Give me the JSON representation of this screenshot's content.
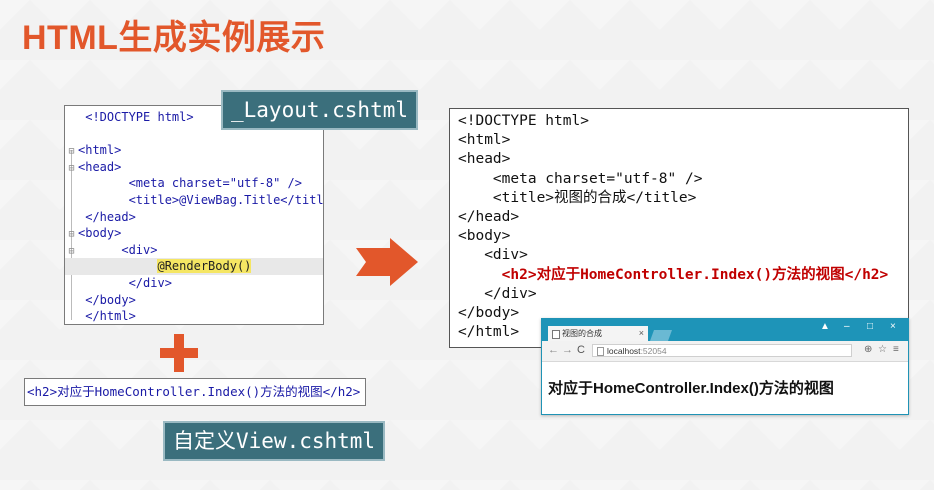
{
  "slide": {
    "title": "HTML生成实例展示"
  },
  "layout_file": {
    "label": "_Layout.cshtml",
    "lines": [
      "<!DOCTYPE html>",
      "",
      "<html>",
      "<head>",
      "<meta charset=\"utf-8\" />",
      "<title>@ViewBag.Title</title>",
      "</head>",
      "<body>",
      "<div>",
      "@RenderBody()",
      "</div>",
      "</body>",
      "</html>"
    ]
  },
  "view_file": {
    "label": "自定义View.cshtml",
    "code": "<h2>对应于HomeController.Index()方法的视图</h2>"
  },
  "result_html": {
    "lines": [
      "<!DOCTYPE html>",
      "<html>",
      "<head>",
      "    <meta charset=\"utf-8\" />",
      "    <title>视图的合成</title>",
      "</head>",
      "<body>",
      "   <div>",
      "     <h2>对应于HomeController.Index()方法的视图</h2>",
      "   </div>",
      "</body>",
      "</html>"
    ]
  },
  "browser": {
    "tab_title": "视图的合成",
    "tab_close": "×",
    "address": "localhost",
    "port": ":52054",
    "heading": "对应于HomeController.Index()方法的视图",
    "window_controls": {
      "user": "▲",
      "minimize": "–",
      "maximize": "□",
      "close": "×"
    }
  },
  "colors": {
    "accent": "#e2572b",
    "label_bg": "#3b6f7c",
    "browser_bar": "#1e94b8",
    "highlight_red": "#c00000"
  }
}
